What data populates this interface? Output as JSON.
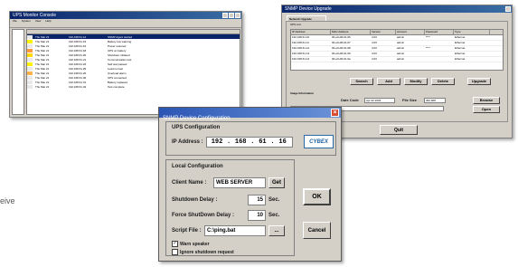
{
  "side_text": "eive",
  "log_window": {
    "title": "UPS Monitor Console",
    "menu": [
      "File",
      "System",
      "View",
      "Help"
    ],
    "rows": [
      {
        "time": "Thu Mar 21",
        "ip": "192.168.61.12",
        "msg": "SNMP Agent started"
      },
      {
        "time": "Thu Mar 21",
        "ip": "192.168.61.15",
        "msg": "Battery low warning"
      },
      {
        "time": "Thu Mar 21",
        "ip": "192.168.61.16",
        "msg": "Power restored"
      },
      {
        "time": "Thu Mar 21",
        "ip": "192.168.61.18",
        "msg": "UPS on battery"
      },
      {
        "time": "Thu Mar 21",
        "ip": "192.168.61.20",
        "msg": "Shutdown initiated"
      },
      {
        "time": "Thu Mar 21",
        "ip": "192.168.61.21",
        "msg": "Communication lost"
      },
      {
        "time": "Thu Mar 21",
        "ip": "192.168.61.22",
        "msg": "Self test passed"
      },
      {
        "time": "Thu Mar 21",
        "ip": "192.168.61.25",
        "msg": "Load normal"
      },
      {
        "time": "Thu Mar 21",
        "ip": "192.168.61.26",
        "msg": "Overload alarm"
      },
      {
        "time": "Thu Mar 21",
        "ip": "192.168.61.30",
        "msg": "UPS connected"
      },
      {
        "time": "Thu Mar 21",
        "ip": "192.168.61.31",
        "msg": "Battery replaced"
      },
      {
        "time": "Thu Mar 21",
        "ip": "192.168.61.32",
        "msg": "Test complete"
      }
    ]
  },
  "upgrade_window": {
    "title": "SNMP Device Upgrade",
    "tab_label": "Network Upgrade",
    "ups_list_label": "UPS List",
    "headers": [
      "IP Address",
      "MAC Address",
      "Version",
      "Account",
      "Password",
      "Type"
    ],
    "rows": [
      {
        "ip": "192.168.61.10",
        "mac": "00-e0-d8-01-06",
        "ver": "4.03",
        "acct": "admin",
        "pwd": "****",
        "type": "Ethernet"
      },
      {
        "ip": "192.168.61.11",
        "mac": "00-e0-d8-01-07",
        "ver": "4.03",
        "acct": "admin",
        "pwd": "",
        "type": "Ethernet"
      },
      {
        "ip": "192.168.61.12",
        "mac": "00-e0-d8-01-08",
        "ver": "4.03",
        "acct": "admin",
        "pwd": "****",
        "type": "Ethernet"
      },
      {
        "ip": "192.168.61.13",
        "mac": "00-e0-d8-01-09",
        "ver": "4.03",
        "acct": "admin",
        "pwd": "",
        "type": "Ethernet"
      },
      {
        "ip": "192.168.61.14",
        "mac": "00-e0-d8-01-0a",
        "ver": "4.03",
        "acct": "admin",
        "pwd": "",
        "type": "Ethernet"
      }
    ],
    "buttons": [
      "Search",
      "Add",
      "Modify",
      "Delete",
      "Upgrade"
    ],
    "image_info_label": "Image Information",
    "date_label": "Date Code",
    "date_value": "Apr 02 2003",
    "size_label": "File Size",
    "size_value": "362,908",
    "path_value": "SNMPWEB.BIN",
    "browse_label": "Browse",
    "open_label": "Open",
    "exit_label": "Quit"
  },
  "config_dialog": {
    "title": "SNMP Device Configuration",
    "ups_section": "UPS Configuration",
    "ip_label": "IP Address :",
    "ip_parts": [
      "192",
      "168",
      "61",
      "16"
    ],
    "local_section": "Local Configuration",
    "client_label": "Client Name :",
    "client_value": "WEB SERVER",
    "get_label": "Get",
    "shutdown_label": "Shutdown Delay :",
    "shutdown_value": "15",
    "sec_unit": "Sec.",
    "force_label": "Force ShutDown Delay :",
    "force_value": "10",
    "script_label": "Script File :",
    "script_value": "C:\\ping.bat",
    "ellipsis": "...",
    "ok_label": "OK",
    "cancel_label": "Cancel",
    "warn_label": "Warn speaker",
    "warn_checked": true,
    "ignore_label": "Ignore shutdown request",
    "ignore_checked": false,
    "logo_text": "CYBEX"
  }
}
